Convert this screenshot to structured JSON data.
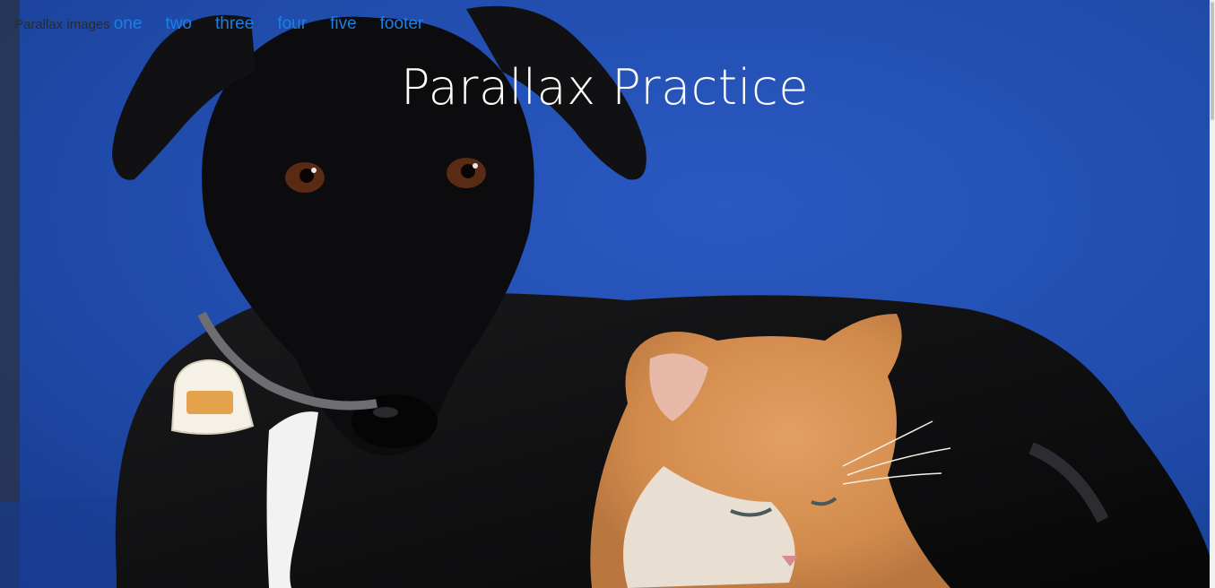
{
  "navbar": {
    "brand": "Parallax images",
    "links": [
      {
        "label": "one"
      },
      {
        "label": "two"
      },
      {
        "label": "three"
      },
      {
        "label": "four"
      },
      {
        "label": "five"
      },
      {
        "label": "footer"
      }
    ]
  },
  "hero": {
    "title": "Parallax Practice"
  },
  "colors": {
    "background_blue": "#1f49a8",
    "link_blue": "#1b7fe6",
    "title_white": "#ffffff"
  }
}
